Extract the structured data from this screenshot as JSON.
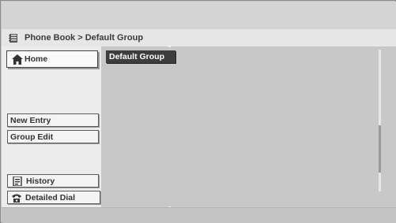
{
  "breadcrumb": {
    "text": "Phone Book > Default Group",
    "icon": "phone-book-icon"
  },
  "sidebar": {
    "home": {
      "label": "Home",
      "icon": "house-icon"
    },
    "new_entry": {
      "label": "New Entry"
    },
    "group_edit": {
      "label": "Group Edit"
    },
    "history": {
      "label": "History",
      "icon": "history-icon"
    },
    "detailed_dial": {
      "label": "Detailed Dial",
      "icon": "phone-dial-icon"
    }
  },
  "main": {
    "group_tag": "Default Group"
  },
  "colors": {
    "frame_bg": "#c8c8c8",
    "sidebar_bg": "#ececec",
    "breadcrumb_bg": "#e6e6e6",
    "group_tag_bg": "#3d3d3d"
  }
}
